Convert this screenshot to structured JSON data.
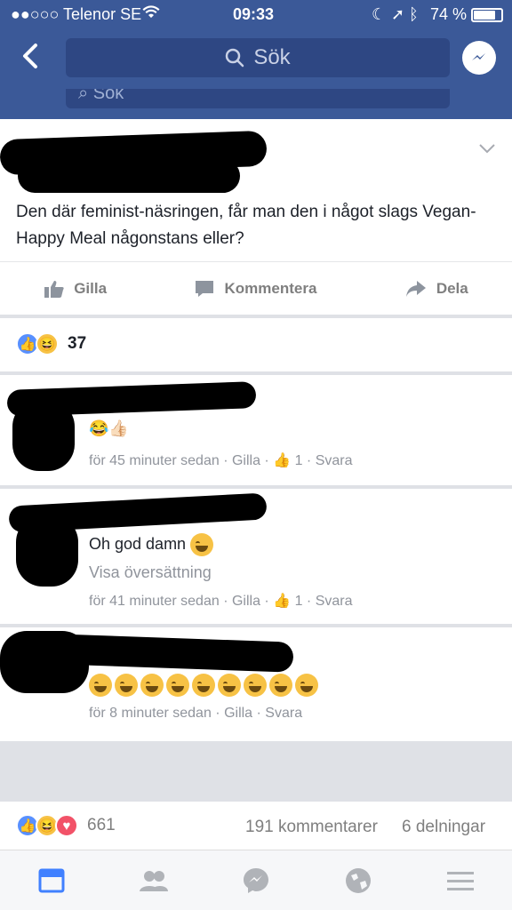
{
  "status": {
    "carrier": "●●○○○ Telenor SE",
    "time": "09:33",
    "battery": "74 %"
  },
  "nav": {
    "search_placeholder": "Sök",
    "ghost_search": "Sök"
  },
  "post": {
    "text": "Den där feminist-näsringen, får man den i något slags Vegan-Happy Meal någonstans eller?",
    "actions": {
      "like": "Gilla",
      "comment": "Kommentera",
      "share": "Dela"
    },
    "reaction_count": "37"
  },
  "comments": [
    {
      "emoji_line": "😂👍🏻",
      "meta": "för 45 minuter sedan · Gilla · ",
      "likes": "1",
      "reply": " · Svara"
    },
    {
      "text": "Oh god damn",
      "translate": "Visa översättning",
      "meta": "för 41 minuter sedan · Gilla · ",
      "likes": "1",
      "reply": " · Svara"
    },
    {
      "emoji_count": 9,
      "meta": "för 8 minuter sedan · Gilla · Svara"
    }
  ],
  "footer": {
    "reactions": "661",
    "comments": "191 kommentarer",
    "shares": "6 delningar"
  },
  "tabs": [
    "news-feed",
    "friends",
    "messenger",
    "notifications-globe",
    "menu"
  ],
  "colors": {
    "brand": "#3b5998",
    "like_blue": "#5890ff",
    "haha_yellow": "#f7c245",
    "love_red": "#f25268"
  }
}
